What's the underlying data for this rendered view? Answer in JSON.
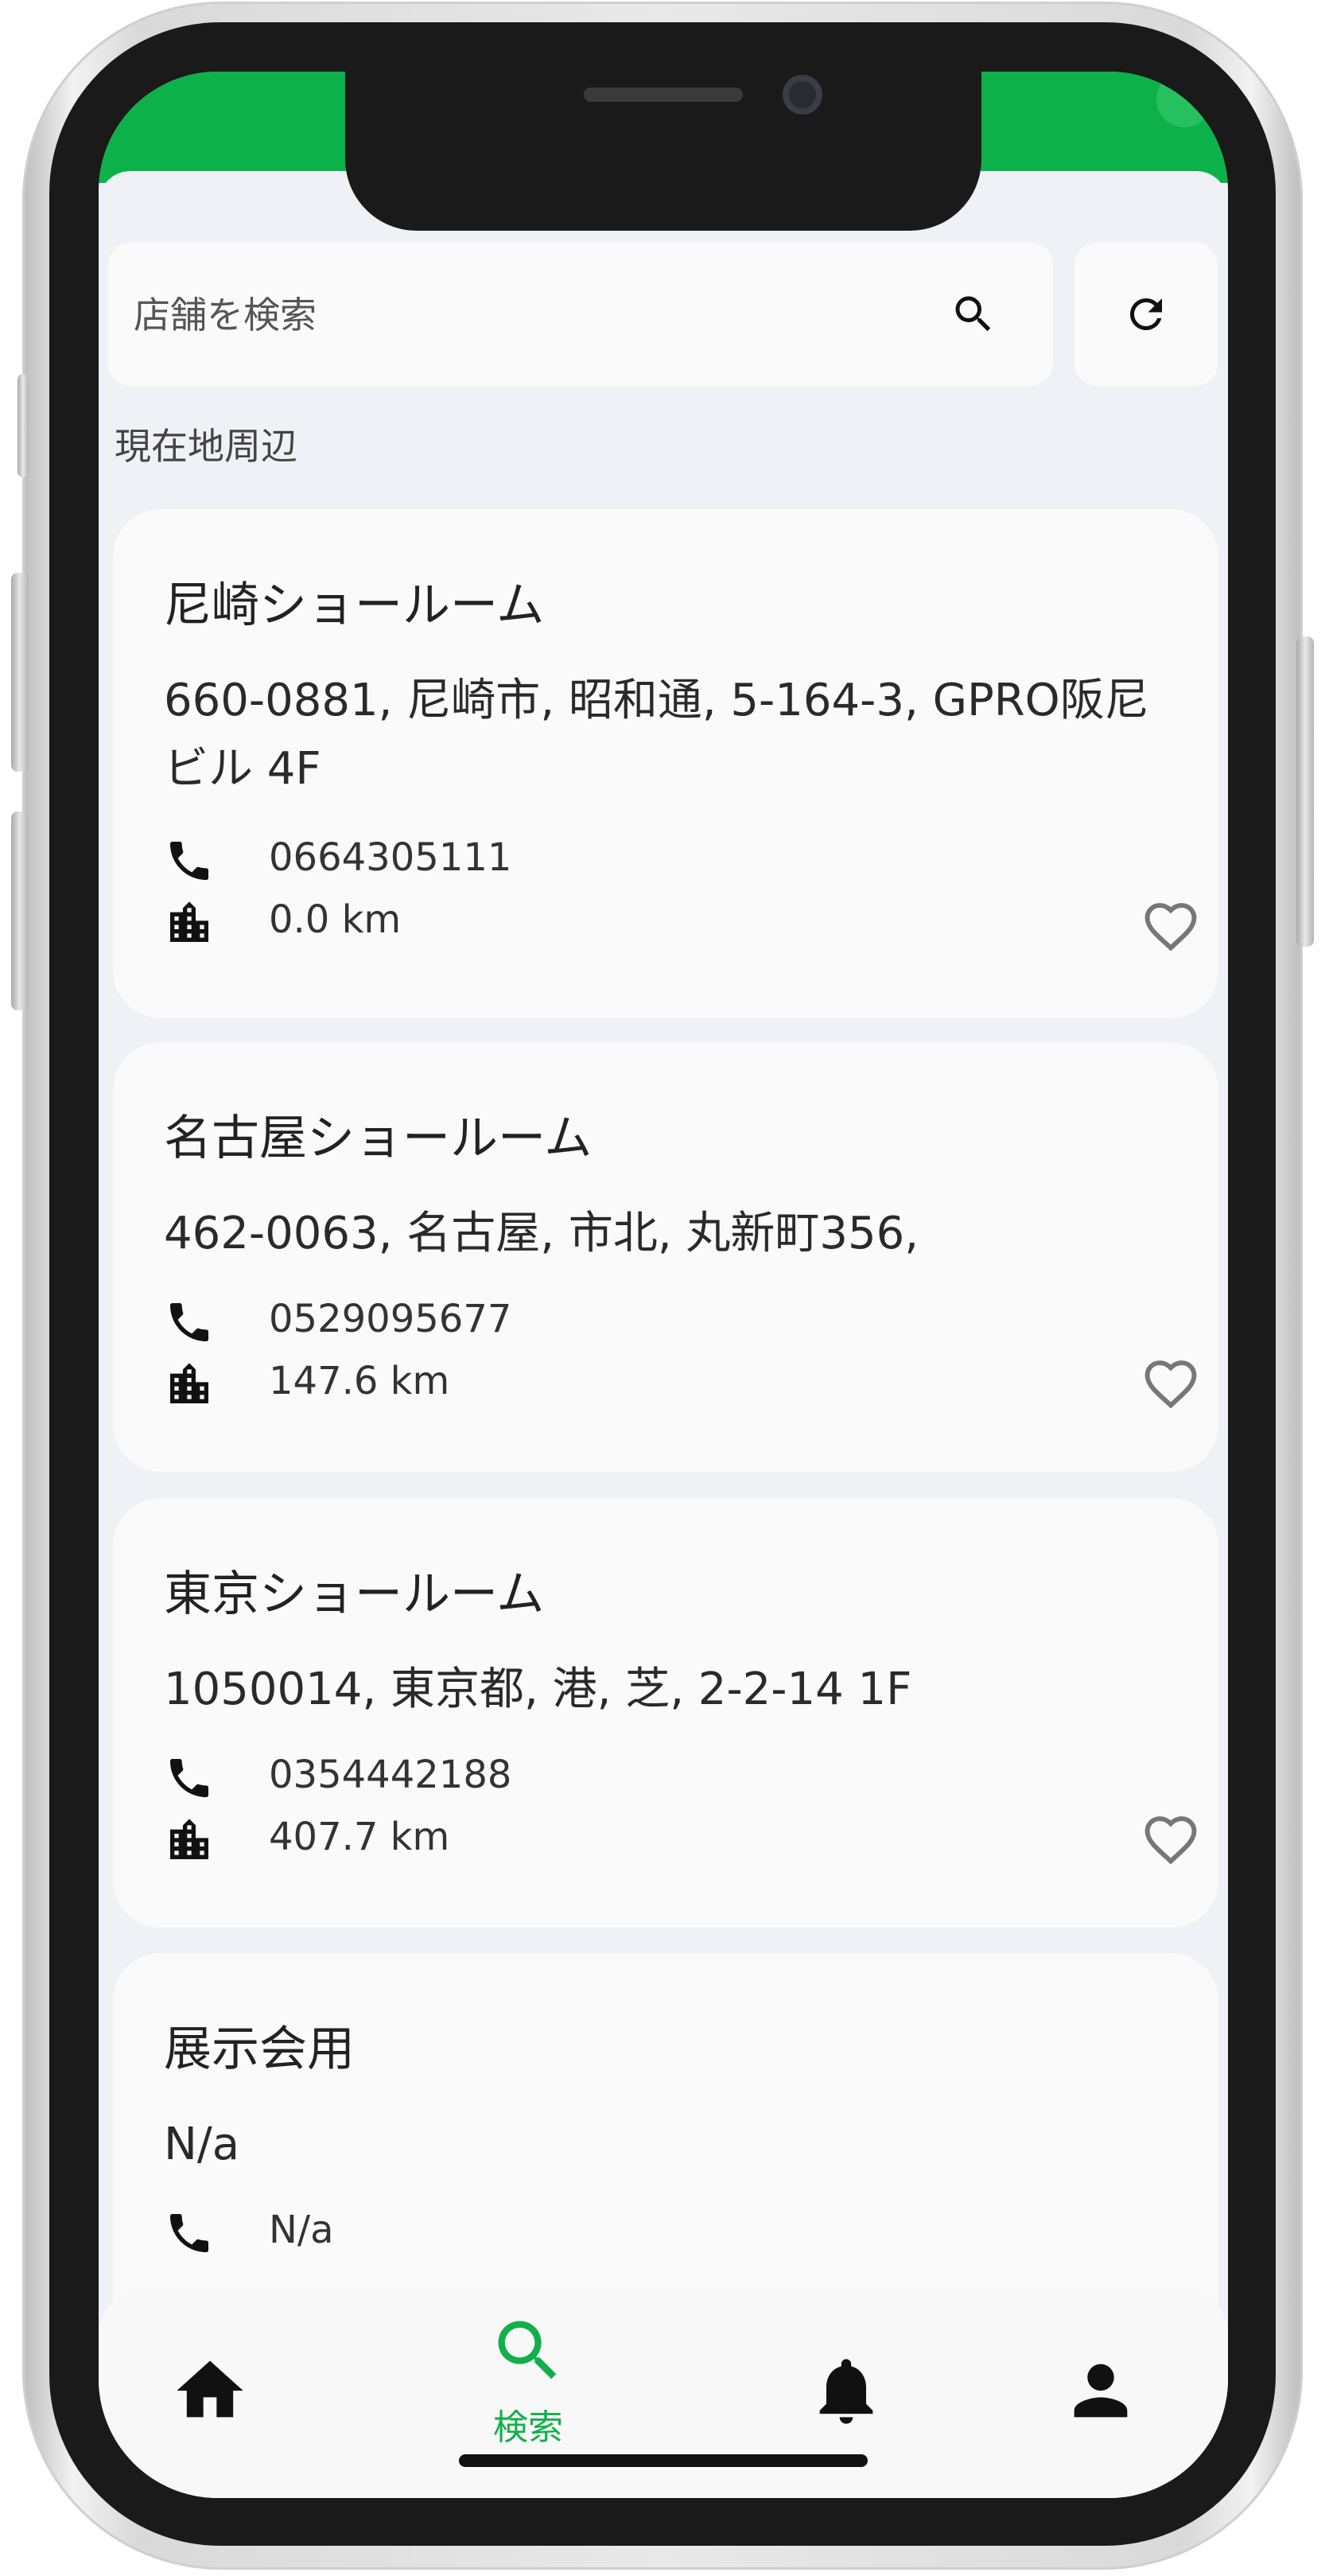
{
  "status_bar": {
    "color": "#0cb249"
  },
  "search": {
    "placeholder": "店舗を検索",
    "search_icon": "search-icon",
    "refresh_icon": "refresh-icon"
  },
  "section_title": "現在地周辺",
  "stores": [
    {
      "name": "尼崎ショールーム",
      "address": "660-0881, 尼崎市, 昭和通, 5-164-3, GPRO阪尼ビル 4F",
      "phone": "0664305111",
      "distance": "0.0 km"
    },
    {
      "name": "名古屋ショールーム",
      "address": "462-0063, 名古屋, 市北, 丸新町356,",
      "phone": "0529095677",
      "distance": "147.6 km"
    },
    {
      "name": "東京ショールーム",
      "address": "1050014, 東京都, 港, 芝, 2-2-14 1F",
      "phone": "0354442188",
      "distance": "407.7 km"
    },
    {
      "name": "展示会用",
      "address": "N/a",
      "phone": "N/a"
    }
  ],
  "bottom_nav": {
    "home_icon": "home-icon",
    "search_label": "検索",
    "search_icon": "search-icon",
    "notifications_icon": "bell-icon",
    "profile_icon": "person-icon",
    "active_color": "#12b04a"
  }
}
